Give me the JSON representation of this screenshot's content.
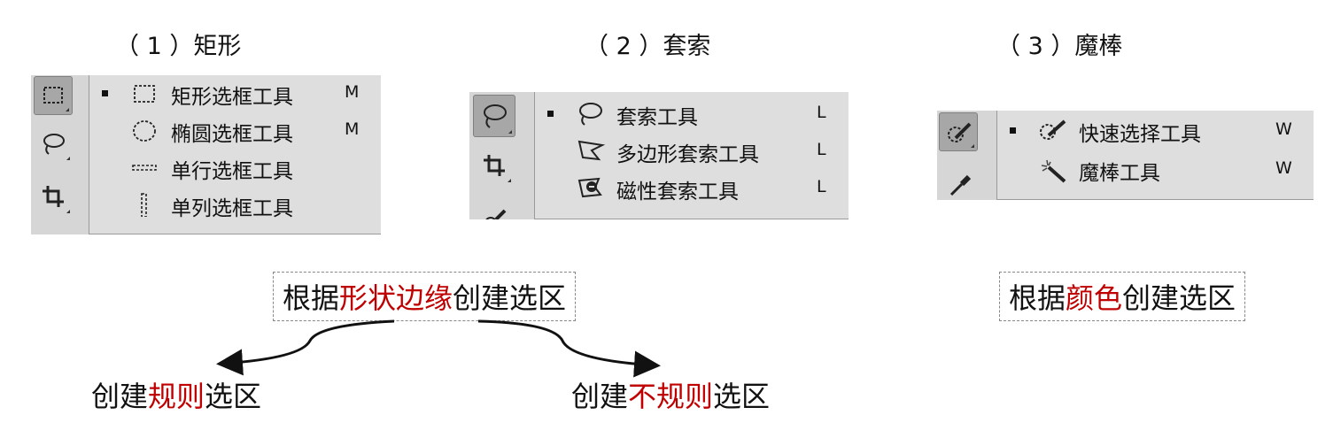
{
  "sections": [
    {
      "title": "（ 1 ）矩形",
      "items": [
        {
          "label": "矩形选框工具",
          "shortcut": "M",
          "icon": "rect-marquee-icon",
          "selected": true
        },
        {
          "label": "椭圆选框工具",
          "shortcut": "M",
          "icon": "elliptical-marquee-icon",
          "selected": false
        },
        {
          "label": "单行选框工具",
          "shortcut": "",
          "icon": "single-row-marquee-icon",
          "selected": false
        },
        {
          "label": "单列选框工具",
          "shortcut": "",
          "icon": "single-column-marquee-icon",
          "selected": false
        }
      ]
    },
    {
      "title": "（ 2 ）套索",
      "items": [
        {
          "label": "套索工具",
          "shortcut": "L",
          "icon": "lasso-icon",
          "selected": true
        },
        {
          "label": "多边形套索工具",
          "shortcut": "L",
          "icon": "polygonal-lasso-icon",
          "selected": false
        },
        {
          "label": "磁性套索工具",
          "shortcut": "L",
          "icon": "magnetic-lasso-icon",
          "selected": false
        }
      ]
    },
    {
      "title": "（ 3 ）魔棒",
      "items": [
        {
          "label": "快速选择工具",
          "shortcut": "W",
          "icon": "quick-selection-icon",
          "selected": true
        },
        {
          "label": "魔棒工具",
          "shortcut": "W",
          "icon": "magic-wand-icon",
          "selected": false
        }
      ]
    }
  ],
  "notes": {
    "shape_box": {
      "pre": "根据",
      "highlight": "形状边缘",
      "post": "创建选区"
    },
    "color_box": {
      "pre": "根据",
      "highlight": "颜色",
      "post": "创建选区"
    },
    "regular": {
      "pre": "创建",
      "highlight": "规则",
      "post": "选区"
    },
    "irregular": {
      "pre": "创建",
      "highlight": "不规则",
      "post": "选区"
    }
  },
  "colors": {
    "highlight": "#c00000",
    "panel": "#dedede",
    "active_tool": "#a7a7a7"
  }
}
